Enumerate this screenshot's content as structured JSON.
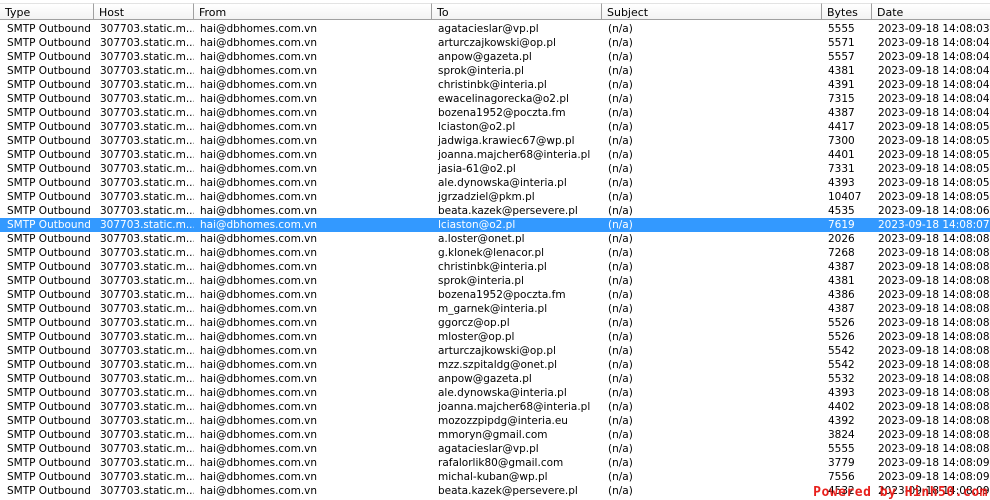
{
  "columns": [
    {
      "key": "type",
      "label": "Type"
    },
    {
      "key": "host",
      "label": "Host"
    },
    {
      "key": "from",
      "label": "From"
    },
    {
      "key": "to",
      "label": "To"
    },
    {
      "key": "subject",
      "label": "Subject"
    },
    {
      "key": "bytes",
      "label": "Bytes"
    },
    {
      "key": "date",
      "label": "Date"
    }
  ],
  "selected_row_index": 14,
  "selection_color": "#3399ff",
  "rows": [
    {
      "type": "SMTP Outbound",
      "host": "307703.static.m...",
      "from": "hai@dbhomes.com.vn",
      "to": "agatacieslar@vp.pl",
      "subject": "(n/a)",
      "bytes": "5555",
      "date": "2023-09-18 14:08:03"
    },
    {
      "type": "SMTP Outbound",
      "host": "307703.static.m...",
      "from": "hai@dbhomes.com.vn",
      "to": "arturczajkowski@op.pl",
      "subject": "(n/a)",
      "bytes": "5571",
      "date": "2023-09-18 14:08:04"
    },
    {
      "type": "SMTP Outbound",
      "host": "307703.static.m...",
      "from": "hai@dbhomes.com.vn",
      "to": "anpow@gazeta.pl",
      "subject": "(n/a)",
      "bytes": "5557",
      "date": "2023-09-18 14:08:04"
    },
    {
      "type": "SMTP Outbound",
      "host": "307703.static.m...",
      "from": "hai@dbhomes.com.vn",
      "to": "sprok@interia.pl",
      "subject": "(n/a)",
      "bytes": "4381",
      "date": "2023-09-18 14:08:04"
    },
    {
      "type": "SMTP Outbound",
      "host": "307703.static.m...",
      "from": "hai@dbhomes.com.vn",
      "to": "christinbk@interia.pl",
      "subject": "(n/a)",
      "bytes": "4391",
      "date": "2023-09-18 14:08:04"
    },
    {
      "type": "SMTP Outbound",
      "host": "307703.static.m...",
      "from": "hai@dbhomes.com.vn",
      "to": "ewacelinagorecka@o2.pl",
      "subject": "(n/a)",
      "bytes": "7315",
      "date": "2023-09-18 14:08:04"
    },
    {
      "type": "SMTP Outbound",
      "host": "307703.static.m...",
      "from": "hai@dbhomes.com.vn",
      "to": "bozena1952@poczta.fm",
      "subject": "(n/a)",
      "bytes": "4387",
      "date": "2023-09-18 14:08:04"
    },
    {
      "type": "SMTP Outbound",
      "host": "307703.static.m...",
      "from": "hai@dbhomes.com.vn",
      "to": "lciaston@o2.pl",
      "subject": "(n/a)",
      "bytes": "4417",
      "date": "2023-09-18 14:08:05"
    },
    {
      "type": "SMTP Outbound",
      "host": "307703.static.m...",
      "from": "hai@dbhomes.com.vn",
      "to": "jadwiga.krawiec67@wp.pl",
      "subject": "(n/a)",
      "bytes": "7300",
      "date": "2023-09-18 14:08:05"
    },
    {
      "type": "SMTP Outbound",
      "host": "307703.static.m...",
      "from": "hai@dbhomes.com.vn",
      "to": "joanna.majcher68@interia.pl",
      "subject": "(n/a)",
      "bytes": "4401",
      "date": "2023-09-18 14:08:05"
    },
    {
      "type": "SMTP Outbound",
      "host": "307703.static.m...",
      "from": "hai@dbhomes.com.vn",
      "to": "jasia-61@o2.pl",
      "subject": "(n/a)",
      "bytes": "7331",
      "date": "2023-09-18 14:08:05"
    },
    {
      "type": "SMTP Outbound",
      "host": "307703.static.m...",
      "from": "hai@dbhomes.com.vn",
      "to": "ale.dynowska@interia.pl",
      "subject": "(n/a)",
      "bytes": "4393",
      "date": "2023-09-18 14:08:05"
    },
    {
      "type": "SMTP Outbound",
      "host": "307703.static.m...",
      "from": "hai@dbhomes.com.vn",
      "to": "jgrzadziel@pkm.pl",
      "subject": "(n/a)",
      "bytes": "10407",
      "date": "2023-09-18 14:08:05"
    },
    {
      "type": "SMTP Outbound",
      "host": "307703.static.m...",
      "from": "hai@dbhomes.com.vn",
      "to": "beata.kazek@persevere.pl",
      "subject": "(n/a)",
      "bytes": "4535",
      "date": "2023-09-18 14:08:06"
    },
    {
      "type": "SMTP Outbound",
      "host": "307703.static.m...",
      "from": "hai@dbhomes.com.vn",
      "to": "lciaston@o2.pl",
      "subject": "(n/a)",
      "bytes": "7619",
      "date": "2023-09-18 14:08:07"
    },
    {
      "type": "SMTP Outbound",
      "host": "307703.static.m...",
      "from": "hai@dbhomes.com.vn",
      "to": "a.loster@onet.pl",
      "subject": "(n/a)",
      "bytes": "2026",
      "date": "2023-09-18 14:08:08"
    },
    {
      "type": "SMTP Outbound",
      "host": "307703.static.m...",
      "from": "hai@dbhomes.com.vn",
      "to": "g.klonek@lenacor.pl",
      "subject": "(n/a)",
      "bytes": "7268",
      "date": "2023-09-18 14:08:08"
    },
    {
      "type": "SMTP Outbound",
      "host": "307703.static.m...",
      "from": "hai@dbhomes.com.vn",
      "to": "christinbk@interia.pl",
      "subject": "(n/a)",
      "bytes": "4387",
      "date": "2023-09-18 14:08:08"
    },
    {
      "type": "SMTP Outbound",
      "host": "307703.static.m...",
      "from": "hai@dbhomes.com.vn",
      "to": "sprok@interia.pl",
      "subject": "(n/a)",
      "bytes": "4381",
      "date": "2023-09-18 14:08:08"
    },
    {
      "type": "SMTP Outbound",
      "host": "307703.static.m...",
      "from": "hai@dbhomes.com.vn",
      "to": "bozena1952@poczta.fm",
      "subject": "(n/a)",
      "bytes": "4386",
      "date": "2023-09-18 14:08:08"
    },
    {
      "type": "SMTP Outbound",
      "host": "307703.static.m...",
      "from": "hai@dbhomes.com.vn",
      "to": "m_garnek@interia.pl",
      "subject": "(n/a)",
      "bytes": "4387",
      "date": "2023-09-18 14:08:08"
    },
    {
      "type": "SMTP Outbound",
      "host": "307703.static.m...",
      "from": "hai@dbhomes.com.vn",
      "to": "ggorcz@op.pl",
      "subject": "(n/a)",
      "bytes": "5526",
      "date": "2023-09-18 14:08:08"
    },
    {
      "type": "SMTP Outbound",
      "host": "307703.static.m...",
      "from": "hai@dbhomes.com.vn",
      "to": "mloster@op.pl",
      "subject": "(n/a)",
      "bytes": "5526",
      "date": "2023-09-18 14:08:08"
    },
    {
      "type": "SMTP Outbound",
      "host": "307703.static.m...",
      "from": "hai@dbhomes.com.vn",
      "to": "arturczajkowski@op.pl",
      "subject": "(n/a)",
      "bytes": "5542",
      "date": "2023-09-18 14:08:08"
    },
    {
      "type": "SMTP Outbound",
      "host": "307703.static.m...",
      "from": "hai@dbhomes.com.vn",
      "to": "mzz.szpitaldg@onet.pl",
      "subject": "(n/a)",
      "bytes": "5542",
      "date": "2023-09-18 14:08:08"
    },
    {
      "type": "SMTP Outbound",
      "host": "307703.static.m...",
      "from": "hai@dbhomes.com.vn",
      "to": "anpow@gazeta.pl",
      "subject": "(n/a)",
      "bytes": "5532",
      "date": "2023-09-18 14:08:08"
    },
    {
      "type": "SMTP Outbound",
      "host": "307703.static.m...",
      "from": "hai@dbhomes.com.vn",
      "to": "ale.dynowska@interia.pl",
      "subject": "(n/a)",
      "bytes": "4393",
      "date": "2023-09-18 14:08:08"
    },
    {
      "type": "SMTP Outbound",
      "host": "307703.static.m...",
      "from": "hai@dbhomes.com.vn",
      "to": "joanna.majcher68@interia.pl",
      "subject": "(n/a)",
      "bytes": "4402",
      "date": "2023-09-18 14:08:08"
    },
    {
      "type": "SMTP Outbound",
      "host": "307703.static.m...",
      "from": "hai@dbhomes.com.vn",
      "to": "mozozzpipdg@interia.eu",
      "subject": "(n/a)",
      "bytes": "4392",
      "date": "2023-09-18 14:08:08"
    },
    {
      "type": "SMTP Outbound",
      "host": "307703.static.m...",
      "from": "hai@dbhomes.com.vn",
      "to": "mmoryn@gmail.com",
      "subject": "(n/a)",
      "bytes": "3824",
      "date": "2023-09-18 14:08:08"
    },
    {
      "type": "SMTP Outbound",
      "host": "307703.static.m...",
      "from": "hai@dbhomes.com.vn",
      "to": "agatacieslar@vp.pl",
      "subject": "(n/a)",
      "bytes": "5555",
      "date": "2023-09-18 14:08:08"
    },
    {
      "type": "SMTP Outbound",
      "host": "307703.static.m...",
      "from": "hai@dbhomes.com.vn",
      "to": "rafalorlik80@gmail.com",
      "subject": "(n/a)",
      "bytes": "3779",
      "date": "2023-09-18 14:08:09"
    },
    {
      "type": "SMTP Outbound",
      "host": "307703.static.m...",
      "from": "hai@dbhomes.com.vn",
      "to": "michal-kuban@wp.pl",
      "subject": "(n/a)",
      "bytes": "7556",
      "date": "2023-09-18 14:08:09"
    },
    {
      "type": "SMTP Outbound",
      "host": "307703.static.m...",
      "from": "hai@dbhomes.com.vn",
      "to": "beata.kazek@persevere.pl",
      "subject": "(n/a)",
      "bytes": "4532",
      "date": "2023-09-18 14:08:09"
    }
  ],
  "watermark": "Powered by Hinh50.com"
}
